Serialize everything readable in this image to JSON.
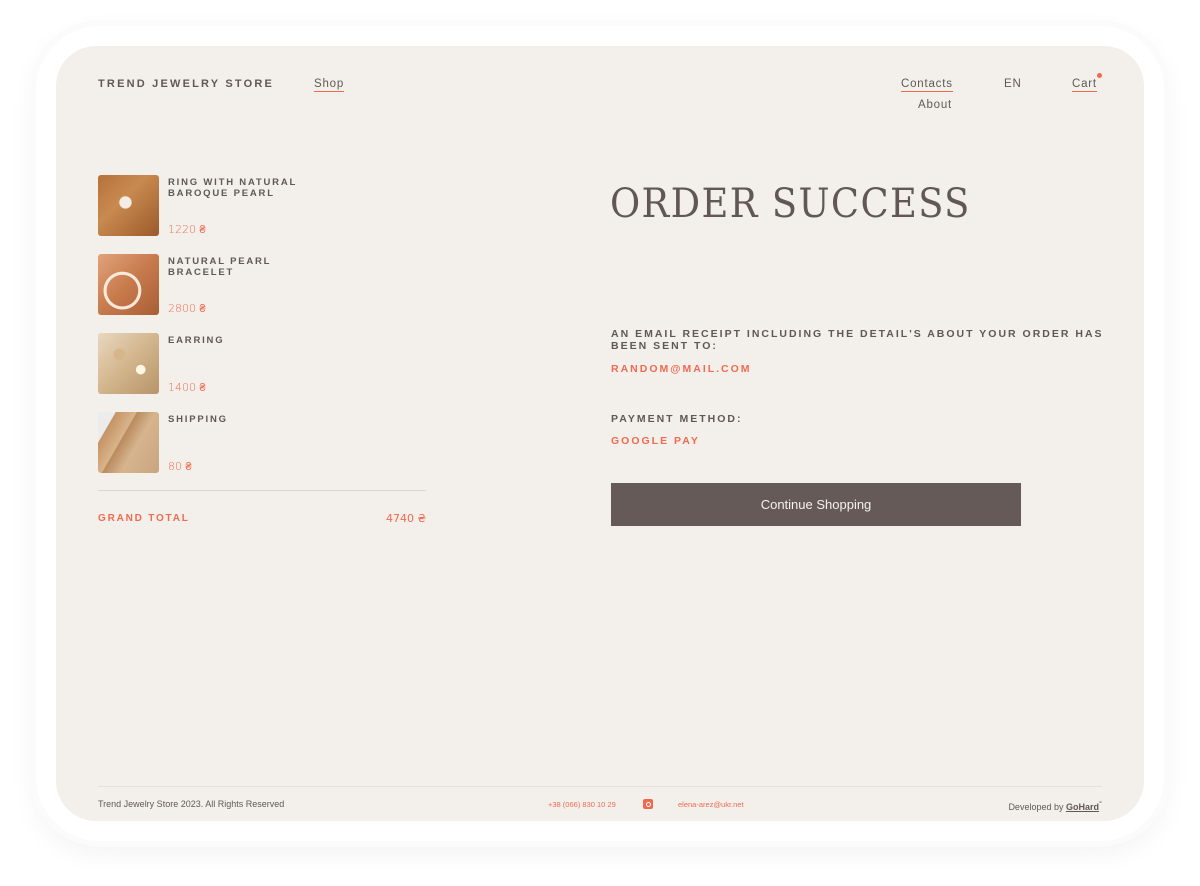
{
  "header": {
    "brand": "TREND JEWELRY STORE",
    "nav": {
      "shop": "Shop",
      "contacts": "Contacts",
      "about": "About",
      "language": "EN",
      "cart": "Cart"
    }
  },
  "order": {
    "items": [
      {
        "name": "RING WITH NATURAL BAROQUE PEARL",
        "price": "1220 ₴",
        "image": "ring-image"
      },
      {
        "name": "NATURAL PEARL BRACELET",
        "price": "2800 ₴",
        "image": "bracelet-image"
      },
      {
        "name": "EARRING",
        "price": "1400 ₴",
        "image": "earring-image"
      },
      {
        "name": "SHIPPING",
        "price": "80 ₴",
        "image": "shipping-image"
      }
    ],
    "grand_total_label": "GRAND TOTAL",
    "grand_total_value": "4740 ₴"
  },
  "success": {
    "title": "ORDER SUCCESS",
    "receipt_text": "AN EMAIL RECEIPT INCLUDING THE DETAIL'S ABOUT YOUR ORDER HAS BEEN SENT TO:",
    "email": "RANDOM@MAIL.COM",
    "payment_label": "PAYMENT METHOD:",
    "payment_value": "GOOGLE PAY",
    "continue_label": "Continue Shopping"
  },
  "footer": {
    "copyright": "Trend Jewelry Store 2023. All Rights Reserved",
    "phone": "+38 (066) 830 10 29",
    "email": "elena-arez@ukr.net",
    "developed_by": "Developed by ",
    "developer": "GoHard",
    "developer_mark": "°"
  },
  "colors": {
    "accent": "#f06a50",
    "text": "#615856",
    "background": "#f3f0ec",
    "button": "#655a58"
  }
}
